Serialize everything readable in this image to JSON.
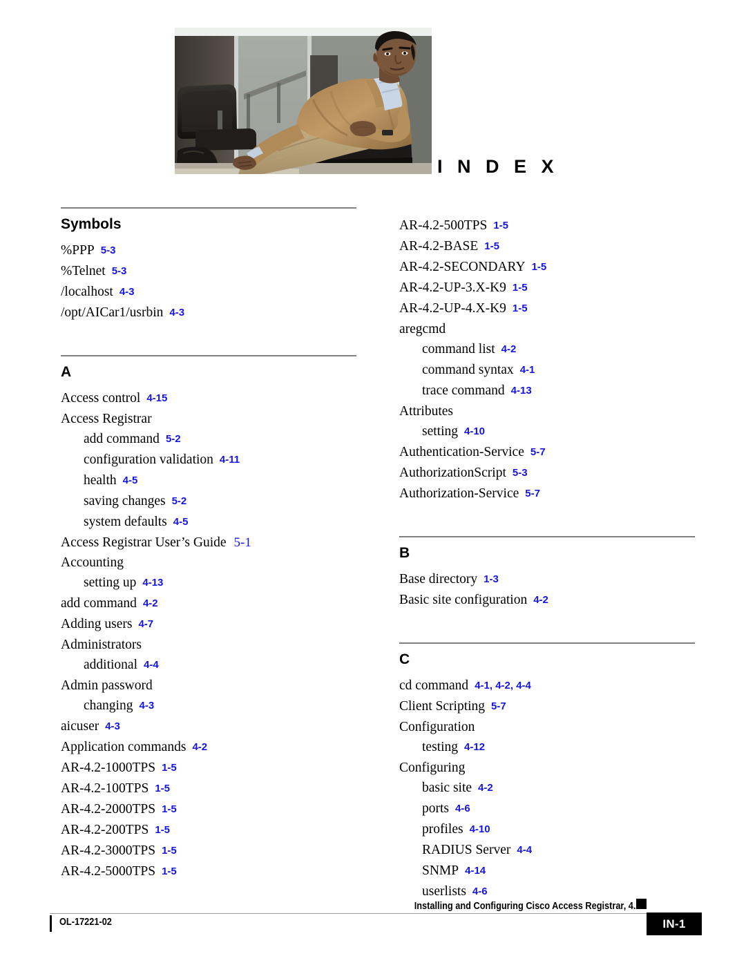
{
  "header": {
    "index_title": "I N D E X",
    "photo_alt": "seated-man-photo"
  },
  "colors": {
    "page_reference": "#1414E6",
    "rule": "#808080",
    "text": "#000000"
  },
  "columns": [
    {
      "id": "left",
      "sections": [
        {
          "letter": "Symbols",
          "entries": [
            {
              "level": 1,
              "term": "%PPP",
              "ref": "5-3",
              "ref_style": "bold"
            },
            {
              "level": 1,
              "term": "%Telnet",
              "ref": "5-3",
              "ref_style": "bold"
            },
            {
              "level": 1,
              "term": "/localhost",
              "ref": "4-3",
              "ref_style": "bold"
            },
            {
              "level": 1,
              "term": "/opt/AICar1/usrbin",
              "ref": "4-3",
              "ref_style": "bold"
            }
          ]
        },
        {
          "letter": "A",
          "entries": [
            {
              "level": 1,
              "term": "Access control",
              "ref": "4-15",
              "ref_style": "bold"
            },
            {
              "level": 1,
              "term": "Access Registrar",
              "ref": "",
              "ref_style": "bold"
            },
            {
              "level": 2,
              "term": "add command",
              "ref": "5-2",
              "ref_style": "bold"
            },
            {
              "level": 2,
              "term": "configuration validation",
              "ref": "4-11",
              "ref_style": "bold"
            },
            {
              "level": 2,
              "term": "health",
              "ref": "4-5",
              "ref_style": "bold"
            },
            {
              "level": 2,
              "term": "saving changes",
              "ref": "5-2",
              "ref_style": "bold"
            },
            {
              "level": 2,
              "term": "system defaults",
              "ref": "4-5",
              "ref_style": "bold"
            },
            {
              "level": 1,
              "term": "Access Registrar User’s Guide",
              "ref": "5-1",
              "ref_style": "serif"
            },
            {
              "level": 1,
              "term": "Accounting",
              "ref": "",
              "ref_style": "bold"
            },
            {
              "level": 2,
              "term": "setting up",
              "ref": "4-13",
              "ref_style": "bold"
            },
            {
              "level": 1,
              "term": "add command",
              "ref": "4-2",
              "ref_style": "bold"
            },
            {
              "level": 1,
              "term": "Adding users",
              "ref": "4-7",
              "ref_style": "bold"
            },
            {
              "level": 1,
              "term": "Administrators",
              "ref": "",
              "ref_style": "bold"
            },
            {
              "level": 2,
              "term": "additional",
              "ref": "4-4",
              "ref_style": "bold"
            },
            {
              "level": 1,
              "term": "Admin password",
              "ref": "",
              "ref_style": "bold"
            },
            {
              "level": 2,
              "term": "changing",
              "ref": "4-3",
              "ref_style": "bold"
            },
            {
              "level": 1,
              "term": "aicuser",
              "ref": "4-3",
              "ref_style": "bold"
            },
            {
              "level": 1,
              "term": "Application commands",
              "ref": "4-2",
              "ref_style": "bold"
            },
            {
              "level": 1,
              "term": "AR-4.2-1000TPS",
              "ref": "1-5",
              "ref_style": "bold"
            },
            {
              "level": 1,
              "term": "AR-4.2-100TPS",
              "ref": "1-5",
              "ref_style": "bold"
            },
            {
              "level": 1,
              "term": "AR-4.2-2000TPS",
              "ref": "1-5",
              "ref_style": "bold"
            },
            {
              "level": 1,
              "term": "AR-4.2-200TPS",
              "ref": "1-5",
              "ref_style": "bold"
            },
            {
              "level": 1,
              "term": "AR-4.2-3000TPS",
              "ref": "1-5",
              "ref_style": "bold"
            },
            {
              "level": 1,
              "term": "AR-4.2-5000TPS",
              "ref": "1-5",
              "ref_style": "bold"
            }
          ]
        }
      ]
    },
    {
      "id": "right",
      "sections": [
        {
          "letter": "",
          "entries": [
            {
              "level": 1,
              "term": "AR-4.2-500TPS",
              "ref": "1-5",
              "ref_style": "bold"
            },
            {
              "level": 1,
              "term": "AR-4.2-BASE",
              "ref": "1-5",
              "ref_style": "bold"
            },
            {
              "level": 1,
              "term": "AR-4.2-SECONDARY",
              "ref": "1-5",
              "ref_style": "bold"
            },
            {
              "level": 1,
              "term": "AR-4.2-UP-3.X-K9",
              "ref": "1-5",
              "ref_style": "bold"
            },
            {
              "level": 1,
              "term": "AR-4.2-UP-4.X-K9",
              "ref": "1-5",
              "ref_style": "bold"
            },
            {
              "level": 1,
              "term": "aregcmd",
              "ref": "",
              "ref_style": "bold"
            },
            {
              "level": 2,
              "term": "command list",
              "ref": "4-2",
              "ref_style": "bold"
            },
            {
              "level": 2,
              "term": "command syntax",
              "ref": "4-1",
              "ref_style": "bold"
            },
            {
              "level": 2,
              "term": "trace command",
              "ref": "4-13",
              "ref_style": "bold"
            },
            {
              "level": 1,
              "term": "Attributes",
              "ref": "",
              "ref_style": "bold"
            },
            {
              "level": 2,
              "term": "setting",
              "ref": "4-10",
              "ref_style": "bold"
            },
            {
              "level": 1,
              "term": "Authentication-Service",
              "ref": "5-7",
              "ref_style": "bold"
            },
            {
              "level": 1,
              "term": "AuthorizationScript",
              "ref": "5-3",
              "ref_style": "bold"
            },
            {
              "level": 1,
              "term": "Authorization-Service",
              "ref": "5-7",
              "ref_style": "bold"
            }
          ]
        },
        {
          "letter": "B",
          "entries": [
            {
              "level": 1,
              "term": "Base directory",
              "ref": "1-3",
              "ref_style": "bold"
            },
            {
              "level": 1,
              "term": "Basic site configuration",
              "ref": "4-2",
              "ref_style": "bold"
            }
          ]
        },
        {
          "letter": "C",
          "entries": [
            {
              "level": 1,
              "term": "cd command",
              "ref": "4-1, 4-2, 4-4",
              "ref_style": "bold"
            },
            {
              "level": 1,
              "term": "Client Scripting",
              "ref": "5-7",
              "ref_style": "bold"
            },
            {
              "level": 1,
              "term": "Configuration",
              "ref": "",
              "ref_style": "bold"
            },
            {
              "level": 2,
              "term": "testing",
              "ref": "4-12",
              "ref_style": "bold"
            },
            {
              "level": 1,
              "term": "Configuring",
              "ref": "",
              "ref_style": "bold"
            },
            {
              "level": 2,
              "term": "basic site",
              "ref": "4-2",
              "ref_style": "bold"
            },
            {
              "level": 2,
              "term": "ports",
              "ref": "4-6",
              "ref_style": "bold"
            },
            {
              "level": 2,
              "term": "profiles",
              "ref": "4-10",
              "ref_style": "bold"
            },
            {
              "level": 2,
              "term": "RADIUS Server",
              "ref": "4-4",
              "ref_style": "bold"
            },
            {
              "level": 2,
              "term": "SNMP",
              "ref": "4-14",
              "ref_style": "bold"
            },
            {
              "level": 2,
              "term": "userlists",
              "ref": "4-6",
              "ref_style": "bold"
            }
          ]
        }
      ]
    }
  ],
  "footer": {
    "title": "Installing and Configuring Cisco Access Registrar, 4.2",
    "doc_number": "OL-17221-02",
    "page_number": "IN-1"
  }
}
